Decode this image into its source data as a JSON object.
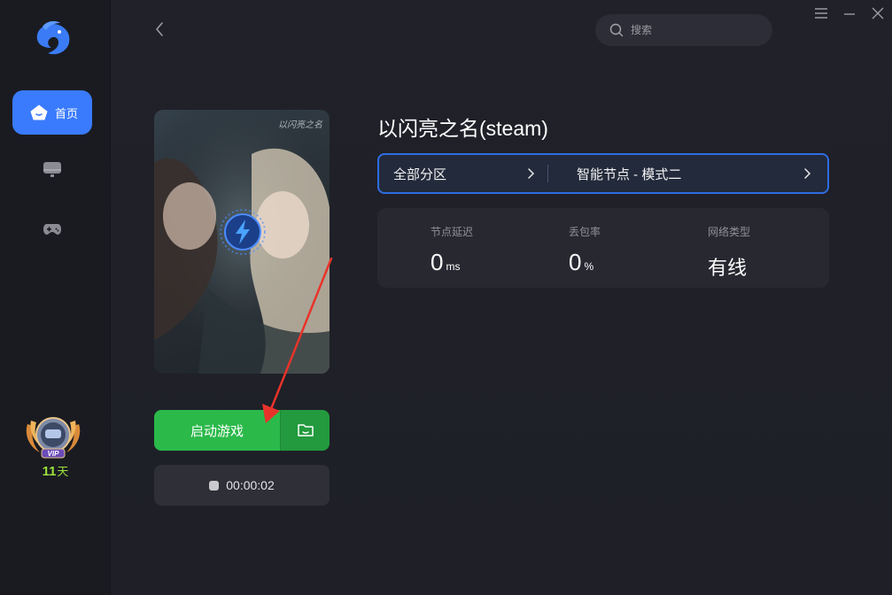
{
  "app": {
    "logo_icon": "dolphin-logo-icon",
    "accent": "#3a7bfd"
  },
  "sidebar": {
    "items": [
      {
        "label": "首页",
        "icon": "home-icon",
        "active": true
      },
      {
        "label": "",
        "icon": "monitor-icon",
        "active": false
      },
      {
        "label": "",
        "icon": "gamepad-icon",
        "active": false
      }
    ],
    "vip": {
      "badge_text": "VIP",
      "days": "11",
      "days_unit": "天"
    }
  },
  "header": {
    "search_placeholder": "搜索",
    "back_icon": "chevron-left-icon",
    "window_controls": [
      "menu-icon",
      "minimize-icon",
      "close-icon"
    ]
  },
  "game": {
    "title": "以闪亮之名(steam)",
    "cover_caption": "以闪亮之名",
    "region_label": "全部分区",
    "node_label": "智能节点 - 模式二",
    "start_label": "启动游戏",
    "timer": "00:00:02",
    "start_color": "#2bb94a"
  },
  "stats": {
    "latency": {
      "label": "节点延迟",
      "value": "0",
      "unit": "ms"
    },
    "loss": {
      "label": "丢包率",
      "value": "0",
      "unit": "%"
    },
    "network": {
      "label": "网络类型",
      "value": "有线"
    }
  }
}
